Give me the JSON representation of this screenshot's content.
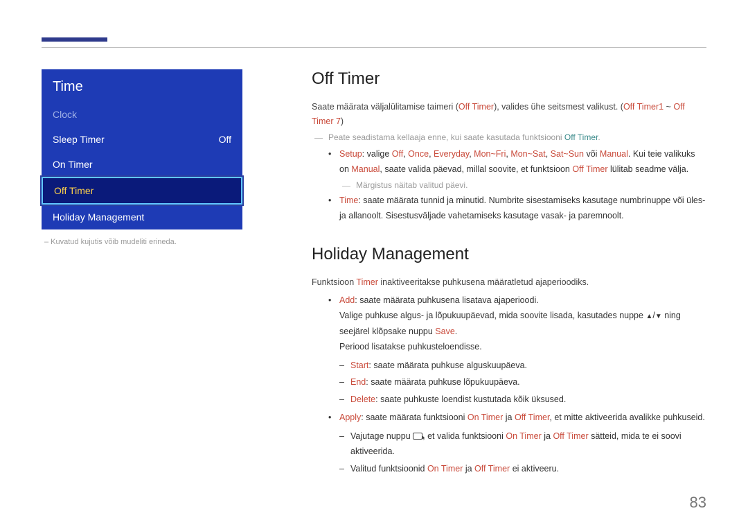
{
  "pageNumber": "83",
  "menu": {
    "title": "Time",
    "items": [
      {
        "label": "Clock",
        "value": "",
        "dim": true
      },
      {
        "label": "Sleep Timer",
        "value": "Off"
      },
      {
        "label": "On Timer",
        "value": ""
      },
      {
        "label": "Off Timer",
        "value": "",
        "selected": true
      },
      {
        "label": "Holiday Management",
        "value": ""
      }
    ],
    "footer": "– Kuvatud kujutis võib mudeliti erineda."
  },
  "offTimer": {
    "heading": "Off Timer",
    "intro_a": "Saate määrata väljalülitamise taimeri (",
    "intro_b": "Off Timer",
    "intro_c": "), valides ühe seitsmest valikust. (",
    "intro_d": "Off Timer1",
    "intro_e": " ~ ",
    "intro_f": "Off Timer 7",
    "intro_g": ")",
    "note": "Peate seadistama kellaaja enne, kui saate kasutada funktsiooni ",
    "note_b": "Off Timer",
    "note_c": ".",
    "setup_label": "Setup",
    "setup_a": ": valige ",
    "opts": [
      "Off",
      "Once",
      "Everyday",
      "Mon~Fri",
      "Mon~Sat",
      "Sat~Sun"
    ],
    "or": " või ",
    "manual": "Manual",
    "setup_b": ". Kui teie valikuks on ",
    "setup_c": ", saate valida päevad, millal soovite, et funktsioon ",
    "setup_off": "Off Timer",
    "setup_d": " lülitab seadme välja.",
    "subnote": "Märgistus näitab valitud päevi.",
    "time_label": "Time",
    "time_text": ": saate määrata tunnid ja minutid. Numbrite sisestamiseks kasutage numbrinuppe või üles- ja allanoolt. Sisestusväljade vahetamiseks kasutage vasak- ja paremnoolt."
  },
  "holiday": {
    "heading": "Holiday Management",
    "intro_a": "Funktsioon ",
    "intro_b": "Timer",
    "intro_c": " inaktiveeritakse puhkusena määratletud ajaperioodiks.",
    "add_label": "Add",
    "add_text": ": saate määrata puhkusena lisatava ajaperioodi.",
    "add_sent_a": "Valige puhkuse algus- ja lõpukuupäevad, mida soovite lisada, kasutades nuppe ",
    "add_sent_b": " ning seejärel klõpsake nuppu ",
    "save": "Save",
    "add_sent_c": ".",
    "period_text": "Periood lisatakse puhkusteloendisse.",
    "start_label": "Start",
    "start_text": ": saate määrata puhkuse alguskuupäeva.",
    "end_label": "End",
    "end_text": ": saate määrata puhkuse lõpukuupäeva.",
    "delete_label": "Delete",
    "delete_text": ": saate puhkuste loendist kustutada kõik üksused.",
    "apply_label": "Apply",
    "apply_a": ": saate määrata funktsiooni ",
    "apply_on": "On Timer",
    "apply_b": " ja ",
    "apply_off": "Off Timer",
    "apply_c": ", et mitte aktiveerida avalikke puhkuseid.",
    "apply_sub1_a": "Vajutage nuppu ",
    "apply_sub1_b": ", et valida funktsiooni ",
    "apply_sub1_c": " sätteid, mida te ei soovi aktiveerida.",
    "apply_sub2_a": "Valitud funktsioonid ",
    "apply_sub2_b": " ei aktiveeru."
  }
}
